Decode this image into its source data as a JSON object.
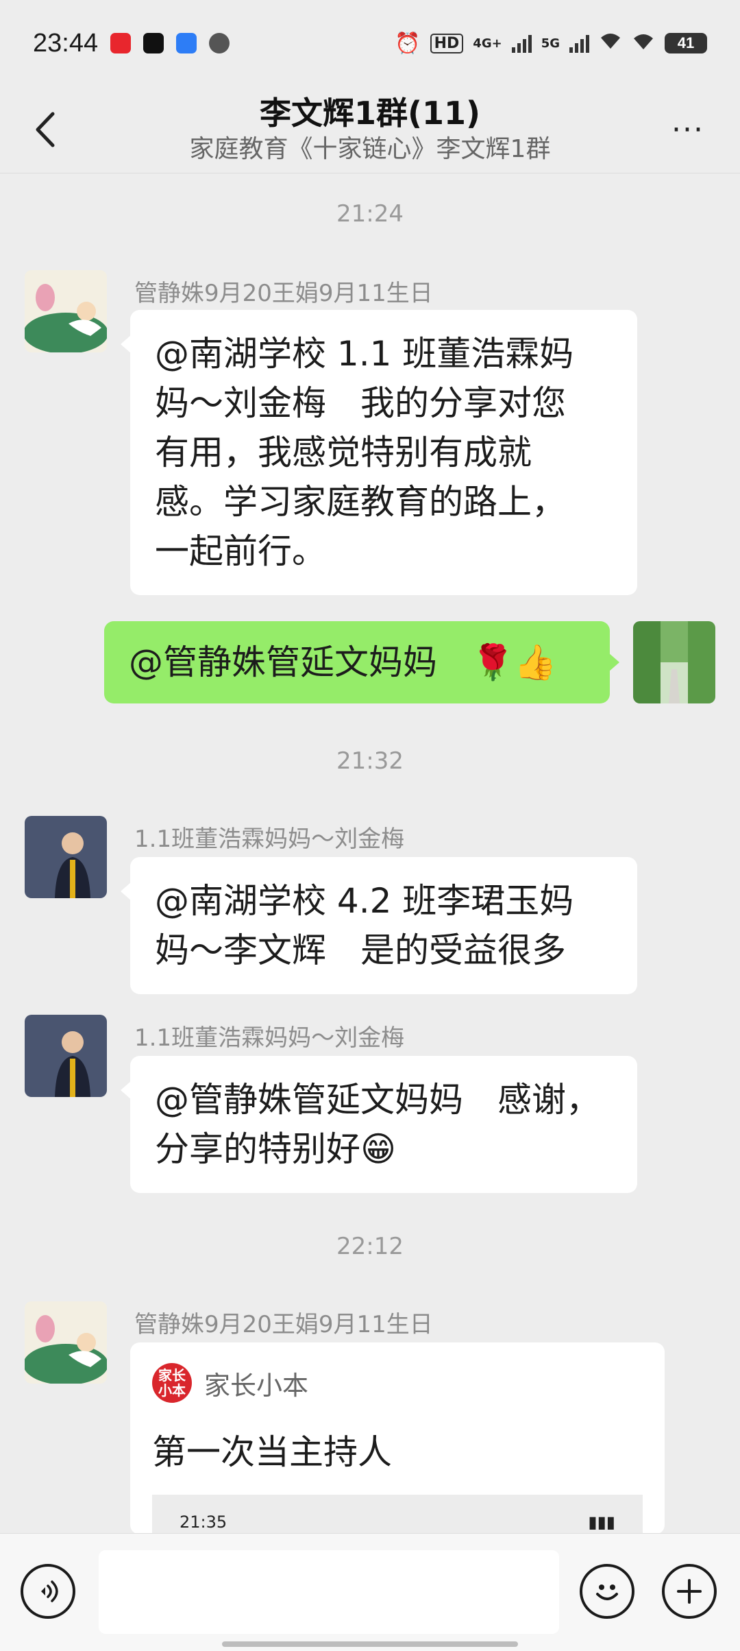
{
  "status_bar": {
    "time": "23:44",
    "icons": [
      "heart-app-icon",
      "tiktok-icon",
      "app-icon",
      "cat-icon",
      "alarm-icon",
      "hd-icon",
      "signal-4g-icon",
      "signal-5g-icon",
      "wifi-icon",
      "wifi-icon-2"
    ],
    "network_labels": [
      "HD",
      "4G+",
      "5G"
    ],
    "battery": "41"
  },
  "header": {
    "title": "李文辉1群(11)",
    "subtitle": "家庭教育《十家链心》李文辉1群",
    "more_label": "···"
  },
  "messages": [
    {
      "type": "time",
      "text": "21:24"
    },
    {
      "type": "incoming",
      "sender": "管静姝9月20王娟9月11生日",
      "lines": [
        "@南湖学校 1.1 班董浩霖妈",
        "妈～刘金梅　我的分享对您",
        "有用，我感觉特别有成就",
        "感。学习家庭教育的路上，",
        "一起前行。"
      ]
    },
    {
      "type": "outgoing",
      "text": "@管静姝管延文妈妈　🌹👍"
    },
    {
      "type": "time",
      "text": "21:32"
    },
    {
      "type": "incoming",
      "sender": "1.1班董浩霖妈妈～刘金梅",
      "lines": [
        "@南湖学校 4.2 班李珺玉妈",
        "妈～李文辉　是的受益很多"
      ]
    },
    {
      "type": "incoming",
      "sender": "1.1班董浩霖妈妈～刘金梅",
      "lines": [
        "@管静姝管延文妈妈　感谢，",
        "分享的特别好😁"
      ]
    },
    {
      "type": "time",
      "text": "22:12"
    },
    {
      "type": "card",
      "sender": "管静姝9月20王娟9月11生日",
      "source": "家长小本",
      "logo_text": "家长小本",
      "title": "第一次当主持人",
      "preview_time": "21:35"
    }
  ],
  "input_bar": {
    "voice_icon": "voice-icon",
    "emoji_icon": "emoji-icon",
    "plus_icon": "plus-icon"
  }
}
